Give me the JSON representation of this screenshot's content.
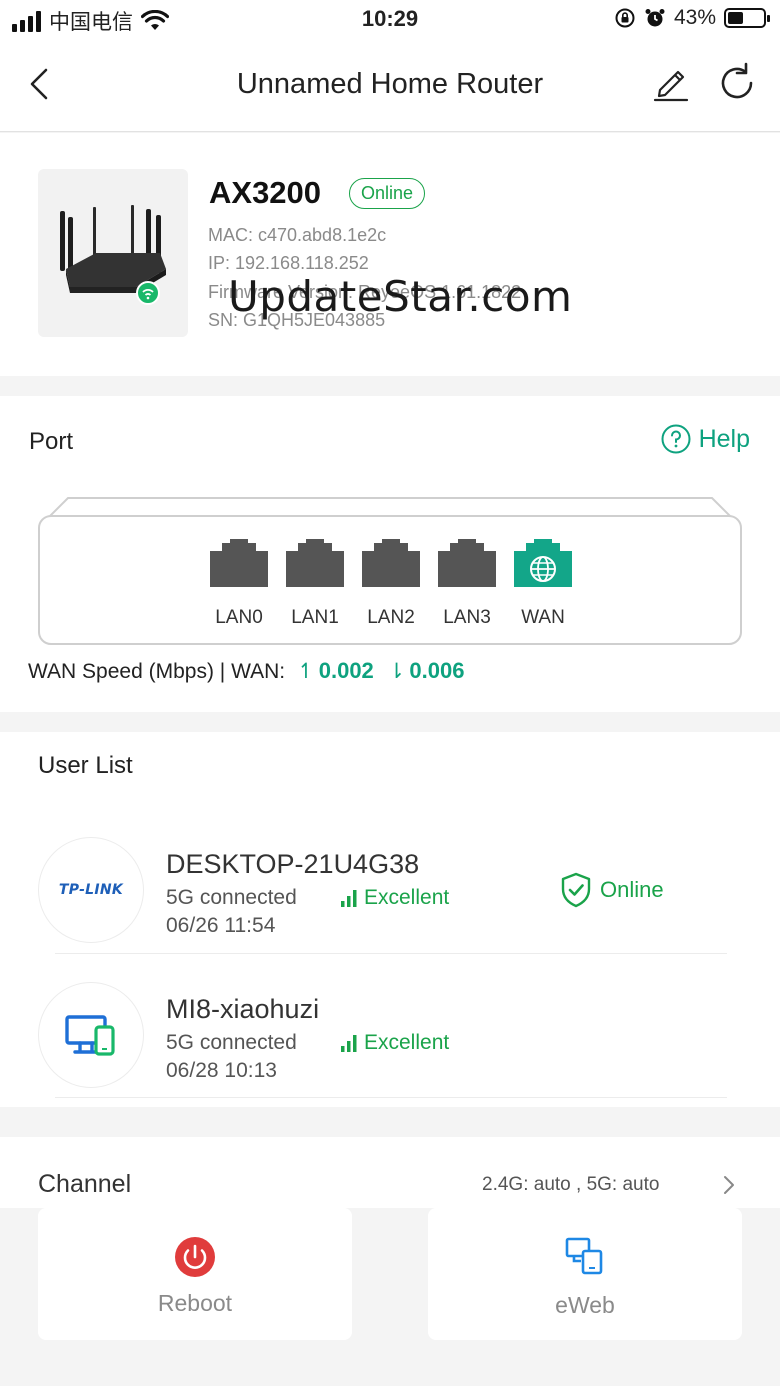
{
  "status_bar": {
    "carrier": "中国电信",
    "time": "10:29",
    "battery": "43%",
    "battery_level": 0.43
  },
  "header": {
    "title": "Unnamed Home Router",
    "back_icon": "chevron-left-icon",
    "edit_icon": "pencil-icon",
    "refresh_icon": "refresh-icon"
  },
  "device": {
    "model": "AX3200",
    "status": "Online",
    "mac": "MAC: c470.abd8.1e2c",
    "ip": "IP: 192.168.118.252",
    "firmware": "Firmware Version: ReyeeOS 1.61.1822",
    "sn": "SN: G1QH5JE043885"
  },
  "port": {
    "title": "Port",
    "help": "Help",
    "ports": [
      {
        "label": "LAN0",
        "active": false
      },
      {
        "label": "LAN1",
        "active": false
      },
      {
        "label": "LAN2",
        "active": false
      },
      {
        "label": "LAN3",
        "active": false
      },
      {
        "label": "WAN",
        "active": true
      }
    ],
    "wan_speed_label": "WAN Speed (Mbps) | WAN:",
    "upload": "0.002",
    "download": "0.006"
  },
  "watermark": "UpdateStar.com",
  "users": {
    "title": "User List",
    "items": [
      {
        "name": "DESKTOP-21U4G38",
        "connection": "5G connected",
        "quality": "Excellent",
        "time": "06/26 11:54",
        "status": "Online",
        "brand": "TP-LINK"
      },
      {
        "name": "MI8-xiaohuzi",
        "connection": "5G connected",
        "quality": "Excellent",
        "time": "06/28 10:13",
        "status": "",
        "brand": ""
      }
    ]
  },
  "channel": {
    "title": "Channel",
    "value": "2.4G: auto , 5G: auto"
  },
  "actions": {
    "reboot": "Reboot",
    "eweb": "eWeb"
  },
  "colors": {
    "accent": "#0ea27f",
    "online": "#1aa34a",
    "reboot": "#e03c3c",
    "eweb": "#1e88e5"
  }
}
